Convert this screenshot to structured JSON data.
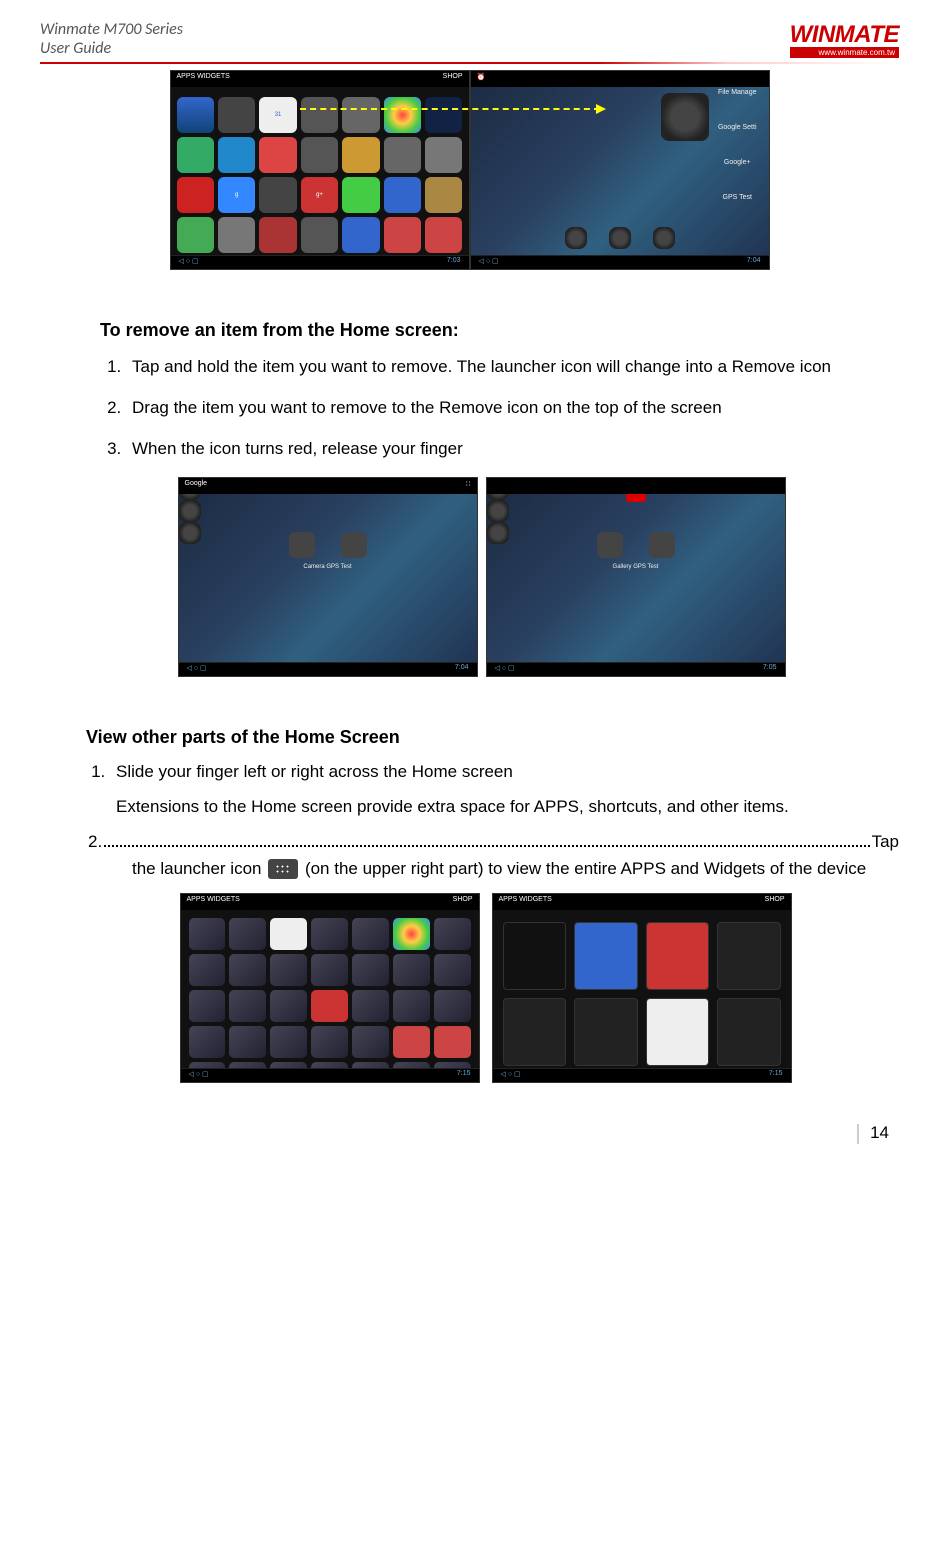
{
  "header": {
    "product": "Winmate M700 Series",
    "subtitle": "User Guide",
    "logo_text": "WINMATE",
    "logo_url": "www.winmate.com.tw"
  },
  "fig1": {
    "top_left_tabs": "APPS   WIDGETS",
    "top_right": "SHOP",
    "home_labels": [
      "File Manage",
      "Google Setti",
      "Google+",
      "GPS Test"
    ],
    "bottombar_time_left": "7:03",
    "bottombar_time_right": "7:04"
  },
  "section_remove": {
    "heading": "To remove an item from the Home screen:",
    "steps": [
      "Tap and hold the item you want to remove. The launcher icon will change into a Remove icon",
      "Drag the item you want to remove to the Remove icon on the top of the screen",
      "When the icon turns red, release your finger"
    ]
  },
  "fig2": {
    "top_left_c1": "Google",
    "c1_center_labels": "Camera     GPS Test",
    "time_c1": "7:04",
    "c2_center_labels": "Gallery     GPS Test",
    "time_c2": "7:05"
  },
  "section_view": {
    "heading": "View other parts of the Home Screen",
    "step1": "Slide your finger left or right across the Home screen",
    "step1_desc": "Extensions to the Home screen provide extra space for APPS, shortcuts, and other items.",
    "step2_num": "2.",
    "step2_trail": "Tap",
    "step2_line_a": "the launcher icon ",
    "step2_line_b": " (on the upper right part) to view the entire APPS and Widgets of the device"
  },
  "fig3": {
    "tabs_left": "APPS   WIDGETS",
    "tabs_left2": "APPS   WIDGETS",
    "shop": "SHOP",
    "time_d": "7:15",
    "time_e": "7:15"
  },
  "page_number": "14"
}
